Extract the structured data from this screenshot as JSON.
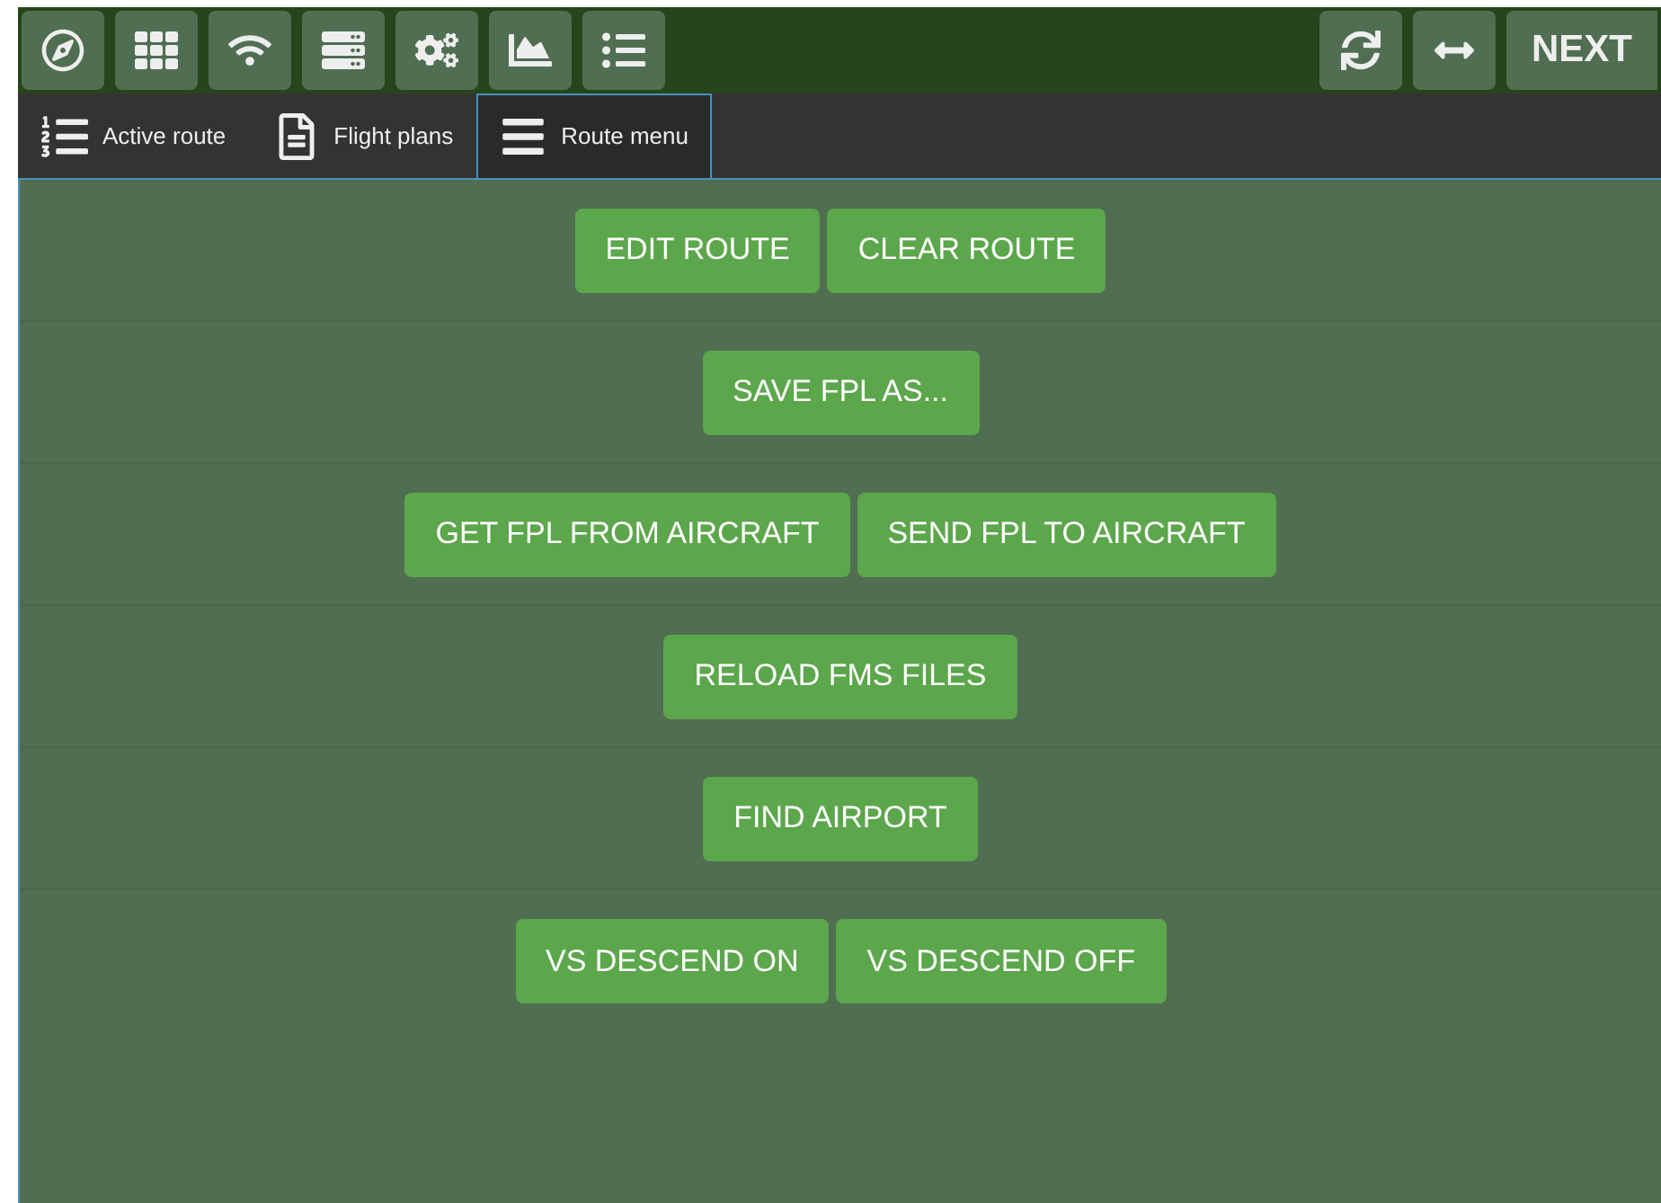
{
  "toolbar": {
    "icon_buttons": [
      {
        "kind": "compass"
      },
      {
        "kind": "grid"
      },
      {
        "kind": "wifi"
      },
      {
        "kind": "server"
      },
      {
        "kind": "cogs"
      },
      {
        "kind": "chart"
      },
      {
        "kind": "list"
      }
    ],
    "right_buttons": [
      {
        "kind": "refresh"
      },
      {
        "kind": "swap"
      }
    ],
    "next_button": "NEXT"
  },
  "tabs": [
    {
      "label": "Active route",
      "kind": "numbered",
      "selected": false
    },
    {
      "label": "Flight plans",
      "kind": "file",
      "selected": false
    },
    {
      "label": "Route menu",
      "kind": "bars",
      "selected": true
    }
  ],
  "rows": [
    [
      "EDIT ROUTE",
      "CLEAR ROUTE"
    ],
    [
      "SAVE FPL AS..."
    ],
    [
      "GET FPL FROM AIRCRAFT",
      "SEND FPL TO AIRCRAFT"
    ],
    [
      "RELOAD FMS FILES"
    ],
    [
      "FIND AIRPORT"
    ],
    [
      "VS DESCEND ON",
      "VS DESCEND OFF"
    ]
  ]
}
